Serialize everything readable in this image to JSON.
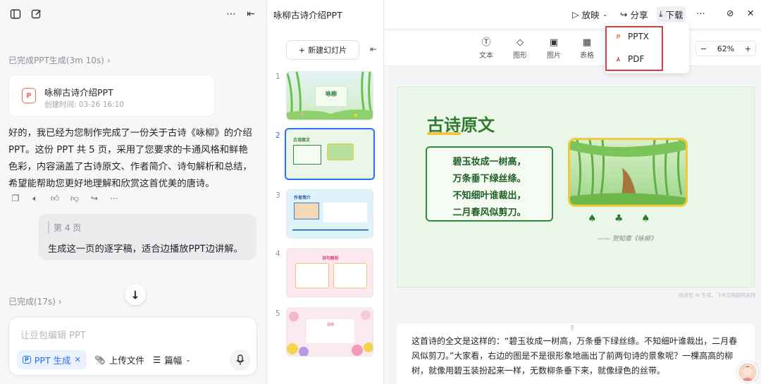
{
  "chat": {
    "status_ppt": "已完成PPT生成(3m 10s)",
    "file_card": {
      "icon": "ppt-file-icon",
      "title": "咏柳古诗介绍PPT",
      "created": "创建时间: 03-26 16:10"
    },
    "assistant_message": "好的，我已经为您制作完成了一份关于古诗《咏柳》的介绍 PPT。这份 PPT 共 5 页，采用了您要求的卡通风格和鲜艳色彩，内容涵盖了古诗原文、作者简介、诗句解析和总结，希望能帮助您更好地理解和欣赏这首优美的唐诗。",
    "user_quote": "第 4 页",
    "user_message": "生成这一页的逐字稿，适合边播放PPT边讲解。",
    "status_done": "已完成(17s)",
    "composer": {
      "placeholder": "让豆包编辑 PPT",
      "chip_label": "PPT 生成",
      "upload_label": "上传文件",
      "length_label": "篇幅"
    }
  },
  "editor": {
    "doc_title": "咏柳古诗介绍PPT",
    "new_slide_label": "新建幻灯片",
    "topbar": {
      "play": "放映",
      "share": "分享",
      "download": "下载"
    },
    "tools": [
      {
        "label": "文本",
        "icon": "text-icon"
      },
      {
        "label": "图形",
        "icon": "shape-icon"
      },
      {
        "label": "图片",
        "icon": "image-icon"
      },
      {
        "label": "表格",
        "icon": "table-icon"
      }
    ],
    "zoom": "62%",
    "download_menu": [
      {
        "label": "PPTX",
        "color": "#f0833a"
      },
      {
        "label": "PDF",
        "color": "#e03a3a"
      }
    ],
    "thumbnails": [
      {
        "num": "1",
        "title": "咏柳"
      },
      {
        "num": "2",
        "title": "古诗原文"
      },
      {
        "num": "3",
        "title": "作者简介"
      },
      {
        "num": "4",
        "title": "诗句解析"
      },
      {
        "num": "5",
        "title": "总结"
      }
    ],
    "slide": {
      "title": "古诗原文",
      "lines": [
        "碧玉妆成一树高，",
        "万条垂下绿丝绦。",
        "不知细叶谁裁出，",
        "二月春风似剪刀。"
      ],
      "author": "—— 贺知章《咏柳》"
    },
    "watermark": "由豆包 AI 生成，飞书文档提供支持",
    "notes": "这首诗的全文是这样的：“碧玉妆成一树高，万条垂下绿丝绦。不知细叶谁裁出，二月春风似剪刀。”大家看，右边的图是不是很形象地画出了前两句诗的景象呢？一棵高高的柳树，就像用碧玉装扮起来一样，无数柳条垂下来，就像绿色的丝带。"
  }
}
